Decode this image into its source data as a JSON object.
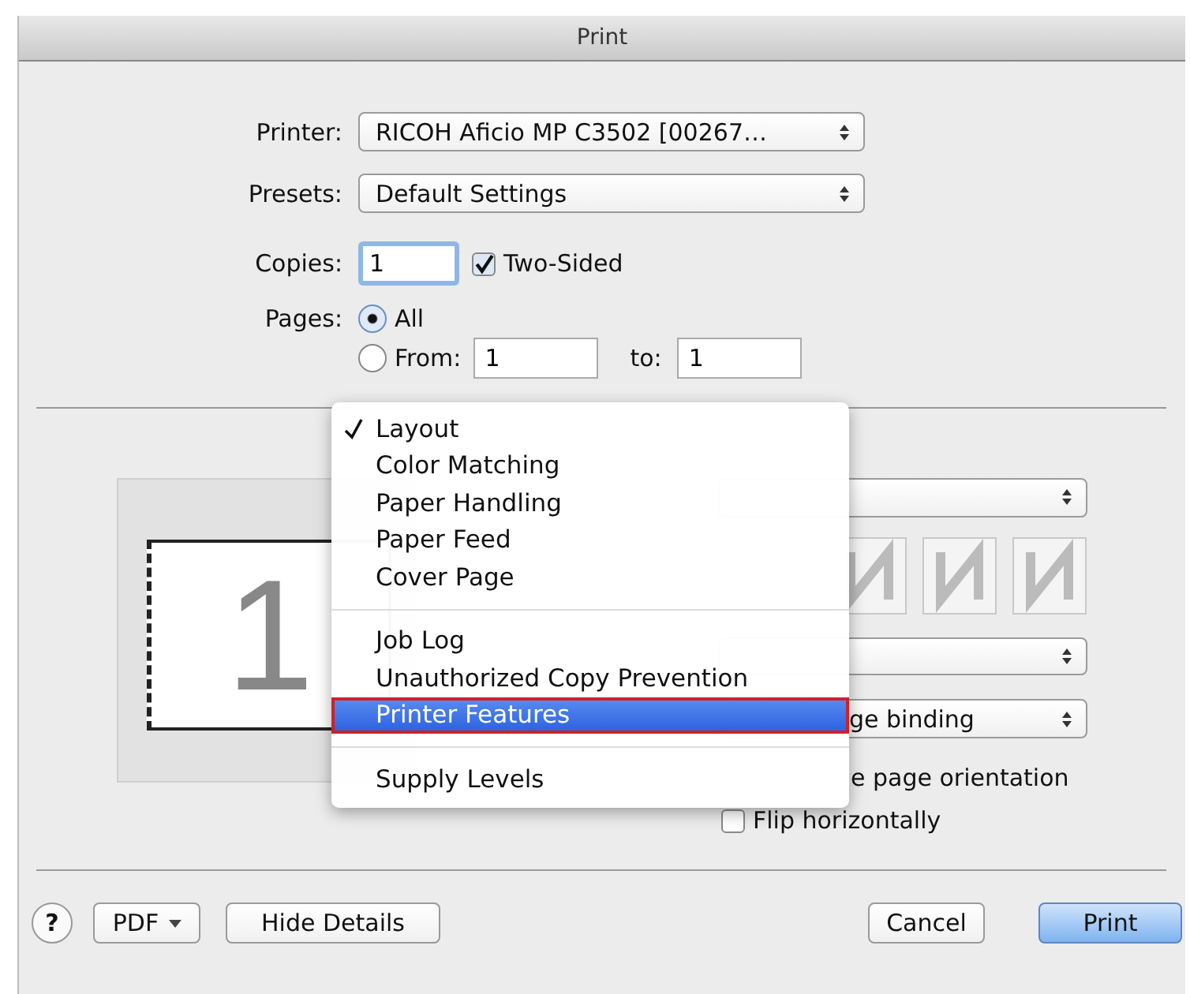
{
  "window": {
    "title": "Print"
  },
  "printer": {
    "label": "Printer:",
    "value": "RICOH Aficio MP C3502 [00267…"
  },
  "presets": {
    "label": "Presets:",
    "value": "Default Settings"
  },
  "copies": {
    "label": "Copies:",
    "value": "1"
  },
  "two_sided": {
    "label": "Two-Sided",
    "checked": true
  },
  "pages": {
    "label": "Pages:",
    "options": [
      {
        "label": "All",
        "selected": true
      },
      {
        "label": "From:",
        "selected": false
      }
    ],
    "from": "1",
    "to_label": "to:",
    "to": "1"
  },
  "preview": {
    "page_number": "1"
  },
  "layout_settings": {
    "binding_value": "ge binding",
    "reverse_label": "e page orientation",
    "flip": {
      "label": "Flip horizontally",
      "checked": false
    }
  },
  "panel_menu": {
    "groups": [
      [
        {
          "label": "Layout",
          "checked": true,
          "selected": false,
          "outlined": false
        },
        {
          "label": "Color Matching",
          "checked": false,
          "selected": false,
          "outlined": false
        },
        {
          "label": "Paper Handling",
          "checked": false,
          "selected": false,
          "outlined": false
        },
        {
          "label": "Paper Feed",
          "checked": false,
          "selected": false,
          "outlined": false
        },
        {
          "label": "Cover Page",
          "checked": false,
          "selected": false,
          "outlined": false
        }
      ],
      [
        {
          "label": "Job Log",
          "checked": false,
          "selected": false,
          "outlined": false
        },
        {
          "label": "Unauthorized Copy Prevention",
          "checked": false,
          "selected": false,
          "outlined": false
        },
        {
          "label": "Printer Features",
          "checked": false,
          "selected": true,
          "outlined": true
        }
      ],
      [
        {
          "label": "Supply Levels",
          "checked": false,
          "selected": false,
          "outlined": false
        }
      ]
    ]
  },
  "buttons": {
    "help": "?",
    "pdf": "PDF",
    "hide_details": "Hide Details",
    "cancel": "Cancel",
    "print": "Print"
  }
}
